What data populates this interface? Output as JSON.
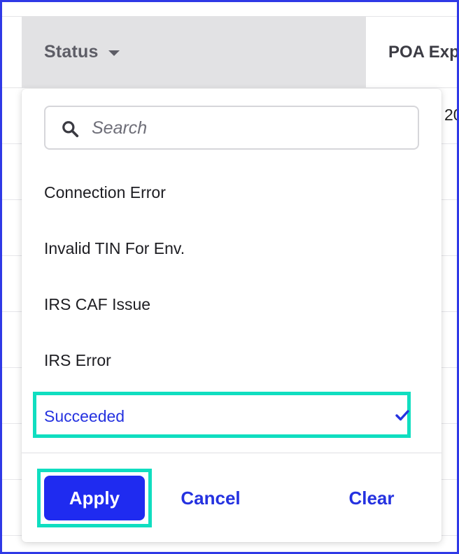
{
  "table": {
    "columns": [
      "Status",
      "POA Exp"
    ],
    "partial_cell": "20"
  },
  "dropdown": {
    "search": {
      "placeholder": "Search",
      "value": ""
    },
    "options": [
      {
        "label": "Connection Error",
        "selected": false
      },
      {
        "label": "Invalid TIN For Env.",
        "selected": false
      },
      {
        "label": "IRS CAF Issue",
        "selected": false
      },
      {
        "label": "IRS Error",
        "selected": false
      },
      {
        "label": "Succeeded",
        "selected": true
      }
    ],
    "actions": {
      "apply": "Apply",
      "cancel": "Cancel",
      "clear": "Clear"
    }
  },
  "colors": {
    "accent": "#1f2bf0",
    "highlight": "#10dec0",
    "header_bg": "#e2e2e4"
  },
  "icons": {
    "search": "search-icon",
    "check": "check-icon",
    "caret": "caret-down-icon"
  }
}
